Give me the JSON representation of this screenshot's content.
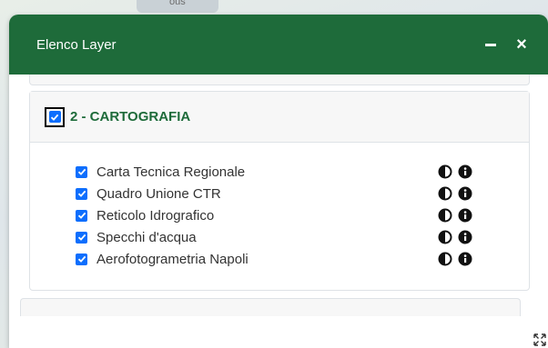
{
  "map": {
    "label": "ous"
  },
  "panel": {
    "title": "Elenco Layer",
    "minimize_icon": "minimize-icon",
    "close_label": "×"
  },
  "group": {
    "title": "2 - CARTOGRAFIA",
    "checked": true
  },
  "layers": [
    {
      "label": "Carta Tecnica Regionale",
      "checked": true
    },
    {
      "label": "Quadro Unione CTR",
      "checked": true
    },
    {
      "label": "Reticolo Idrografico",
      "checked": true
    },
    {
      "label": "Specchi d'acqua",
      "checked": true
    },
    {
      "label": "Aerofotogrametria Napoli",
      "checked": true
    }
  ],
  "icons": {
    "opacity": "contrast-icon",
    "info": "info-icon",
    "resize": "expand-icon"
  },
  "colors": {
    "header": "#1e6b3a",
    "checkbox": "#0d6efd"
  }
}
